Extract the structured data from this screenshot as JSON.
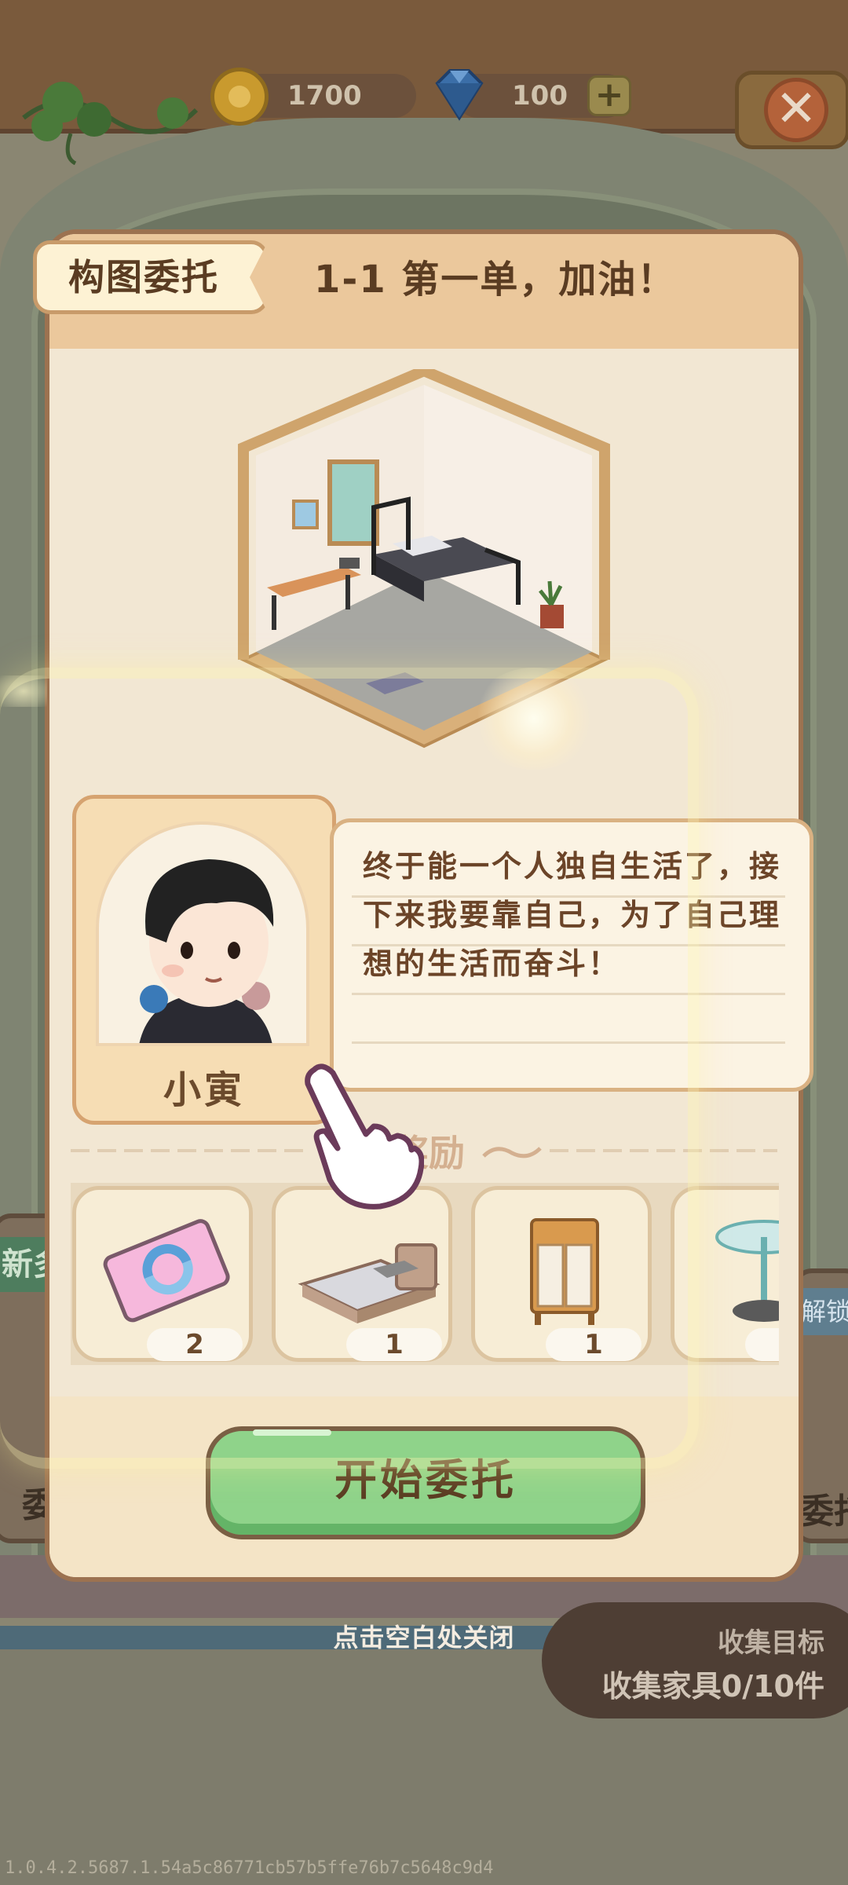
{
  "currency": {
    "coins": "1700",
    "gems": "100",
    "coin_icon": "cat-coin-icon",
    "gem_icon": "diamond-icon",
    "plus_label": "+",
    "close_label": "✕"
  },
  "dialog": {
    "tag": "构图委托",
    "title": "1-1 第一单，加油！",
    "character": {
      "name": "小寅",
      "speech": "终于能一个人独自生活了，接下来我要靠自己，为了自己理想的生活而奋斗！"
    },
    "rewards_title": "奖励",
    "rewards": [
      {
        "icon": "ticket-icon",
        "count": "2"
      },
      {
        "icon": "bed-icon",
        "count": "1"
      },
      {
        "icon": "cabinet-icon",
        "count": "1"
      },
      {
        "icon": "side-table-icon",
        "count": ""
      }
    ],
    "start_button": "开始委托"
  },
  "background": {
    "left_tag": "新多",
    "left_text": "委",
    "right_tag": "解锁",
    "right_text": "委托"
  },
  "footer": {
    "close_hint": "点击空白处关闭",
    "collect_title": "收集目标",
    "collect_value": "收集家具0/10件"
  },
  "version": "1.0.4.2.5687.1.54a5c86771cb57b5ffe76b7c5648c9d4",
  "colors": {
    "accent_green": "#8fd38a",
    "header_tan": "#ebc89c",
    "text_brown": "#5a3c22"
  }
}
